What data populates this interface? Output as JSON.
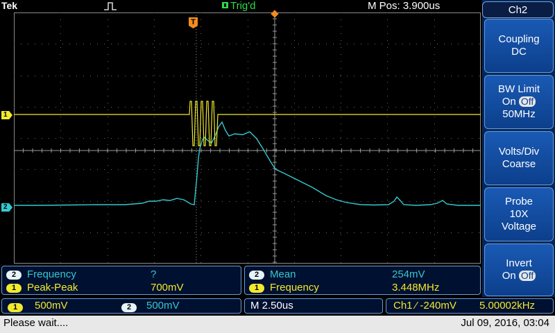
{
  "header": {
    "brand": "Tek",
    "trigger_status": "Trig'd",
    "horizontal_position": "M Pos: 3.900us"
  },
  "markers": {
    "ch1": "1",
    "ch2": "2",
    "trigger": "T"
  },
  "side_menu": {
    "title": "Ch2",
    "buttons": [
      {
        "line1": "Coupling",
        "line2": "DC"
      },
      {
        "line1": "BW Limit",
        "on": "On",
        "off": "Off",
        "line3": "50MHz"
      },
      {
        "line1": "Volts/Div",
        "line2": "Coarse"
      },
      {
        "line1": "Probe",
        "line2": "10X",
        "line3": "Voltage"
      },
      {
        "line1": "Invert",
        "on": "On",
        "off": "Off"
      }
    ]
  },
  "measurements": {
    "left": [
      {
        "channel": "2",
        "name": "Frequency",
        "value": "?"
      },
      {
        "channel": "1",
        "name": "Peak-Peak",
        "value": "700mV"
      }
    ],
    "right": [
      {
        "channel": "2",
        "name": "Mean",
        "value": "254mV"
      },
      {
        "channel": "1",
        "name": "Frequency",
        "value": "3.448MHz"
      }
    ]
  },
  "scales": {
    "ch1_channel": "1",
    "ch1_scale": "500mV",
    "ch2_channel": "2",
    "ch2_scale": "500mV",
    "timebase": "M 2.50us",
    "trigger_info": "Ch1 ⁄ -240mV",
    "trigger_freq": "5.00002kHz"
  },
  "status": {
    "message": "Please wait....",
    "datetime": "Jul 09, 2016, 03:04"
  },
  "colors": {
    "ch1": "#f1ea2e",
    "ch2": "#36c9d0",
    "trigger": "#f28c1e",
    "trig_status": "#2edc4a",
    "menu": "#0c3f8c"
  }
}
